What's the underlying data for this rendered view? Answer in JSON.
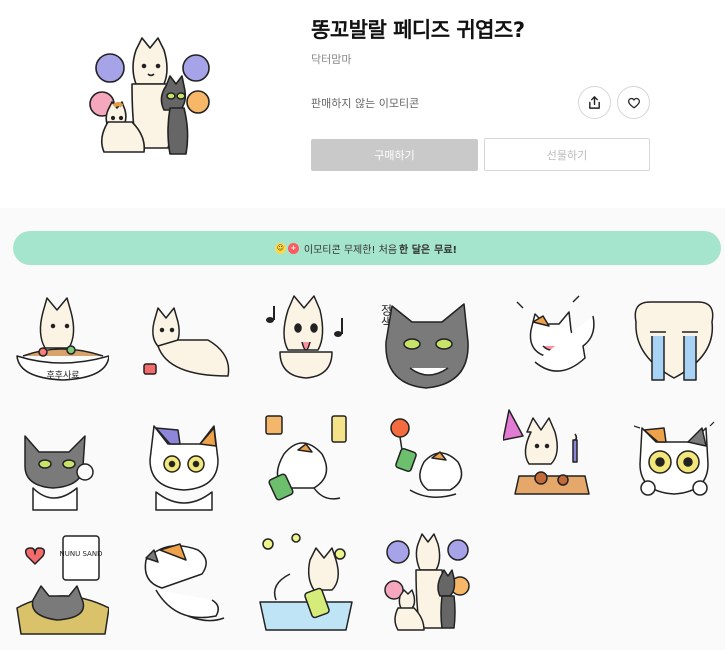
{
  "product": {
    "title": "똥꼬발랄 페디즈 귀엽즈?",
    "author": "닥터맘마",
    "notice": "판매하지 않는 이모티콘"
  },
  "actions": {
    "buy_label": "구매하기",
    "gift_label": "선물하기",
    "share_icon": "share-icon",
    "like_icon": "heart-icon"
  },
  "promo": {
    "prefix": "이모티콘 무제한! 처음",
    "highlight": "한 달은",
    "suffix": "무료!"
  },
  "stickers": {
    "row1": [
      {
        "name": "dog-eating-bowl",
        "text": "후후사료"
      },
      {
        "name": "dog-lying-down"
      },
      {
        "name": "dog-singing-music"
      },
      {
        "name": "cat-staring",
        "text": "정색"
      },
      {
        "name": "cat-laughing"
      },
      {
        "name": "dog-crying"
      }
    ],
    "row2": [
      {
        "name": "cat-thumb-up"
      },
      {
        "name": "cat-shocked"
      },
      {
        "name": "cat-drinking-juice"
      },
      {
        "name": "cat-lollipop"
      },
      {
        "name": "dog-party-pizza"
      },
      {
        "name": "cat-teary-eyes"
      }
    ],
    "row3": [
      {
        "name": "cat-love-snack",
        "text": "NUNU SAND"
      },
      {
        "name": "cat-scratching"
      },
      {
        "name": "dog-bathing"
      },
      {
        "name": "cheerleaders"
      }
    ]
  },
  "colors": {
    "buy_bg": "#c9c9c9",
    "promo_bg": "#a5e5cd",
    "dog_fur": "#fbf3e4",
    "cat_gray": "#666666"
  }
}
